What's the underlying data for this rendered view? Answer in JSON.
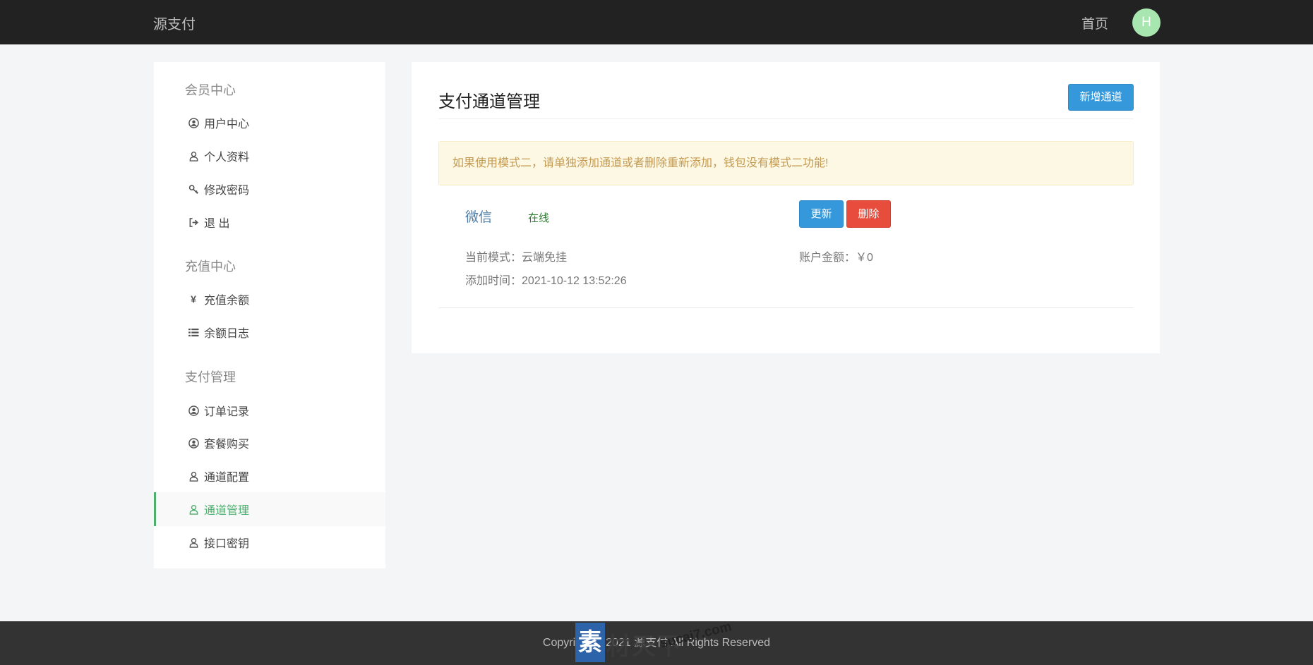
{
  "navbar": {
    "brand": "源支付",
    "home_label": "首页",
    "avatar_letter": "H"
  },
  "sidebar": {
    "groups": [
      {
        "title": "会员中心",
        "items": [
          {
            "label": "用户中心",
            "icon": "user-circle-icon"
          },
          {
            "label": "个人资料",
            "icon": "user-icon"
          },
          {
            "label": "修改密码",
            "icon": "key-icon"
          },
          {
            "label": "退 出",
            "icon": "sign-out-icon"
          }
        ]
      },
      {
        "title": "充值中心",
        "items": [
          {
            "label": "充值余额",
            "icon": "yen-icon"
          },
          {
            "label": "余额日志",
            "icon": "list-icon"
          }
        ]
      },
      {
        "title": "支付管理",
        "items": [
          {
            "label": "订单记录",
            "icon": "user-circle-icon"
          },
          {
            "label": "套餐购买",
            "icon": "user-circle-icon"
          },
          {
            "label": "通道配置",
            "icon": "user-icon"
          },
          {
            "label": "通道管理",
            "icon": "user-icon",
            "active": true
          },
          {
            "label": "接口密钥",
            "icon": "user-icon"
          }
        ]
      }
    ]
  },
  "main": {
    "title": "支付通道管理",
    "add_button": "新增通道",
    "alert": "如果使用模式二，请单独添加通道或者删除重新添加，钱包没有模式二功能!",
    "channel": {
      "name": "微信",
      "status": "在线",
      "update_button": "更新",
      "delete_button": "删除",
      "mode_label": "当前模式：",
      "mode_value": "云端免挂",
      "balance_label": "账户金额：",
      "balance_value": "￥0",
      "added_label": "添加时间：",
      "added_value": "2021-10-12 13:52:26"
    }
  },
  "footer": {
    "text": "Copyright © 2021 源支付 All Rights Reserved"
  },
  "watermark": {
    "box_char": "素",
    "text": "材天下",
    "url": "sucai7.com"
  },
  "colors": {
    "navbar_bg": "#222222",
    "accent_green": "#4caf6d",
    "primary_blue": "#3498db",
    "danger_red": "#e74c3c",
    "alert_bg": "#fdf8e4"
  }
}
